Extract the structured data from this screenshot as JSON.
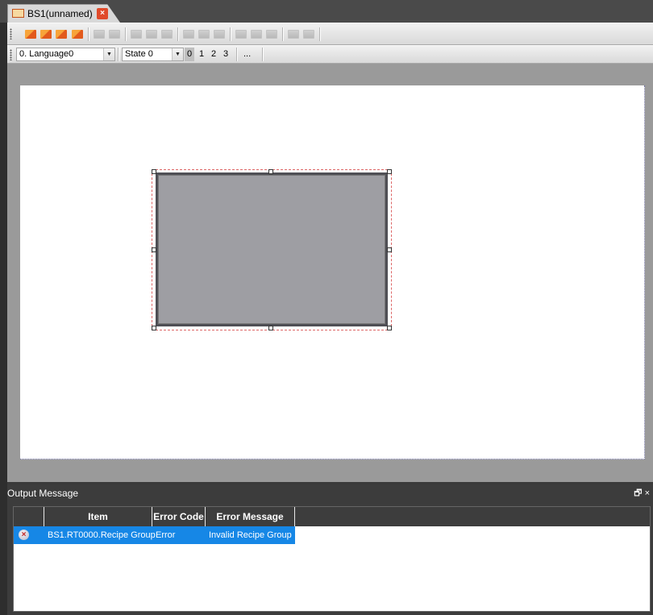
{
  "tab": {
    "title": "BS1(unnamed)",
    "close_glyph": "×"
  },
  "toolbar1": {
    "icons": [
      "bring-forward-icon",
      "bring-to-front-icon",
      "send-backward-icon",
      "send-to-back-icon",
      "group-icon",
      "ungroup-icon",
      "align-left-icon",
      "align-center-icon",
      "align-right-icon",
      "align-top-icon",
      "align-middle-icon",
      "align-bottom-icon",
      "distribute-horizontal-icon",
      "distribute-vertical-icon",
      "same-size-icon",
      "lock-icon",
      "unlock-icon"
    ]
  },
  "toolbar2": {
    "language_value": "0. Language0",
    "state_value": "State 0",
    "state_buttons": [
      "0",
      "1",
      "2",
      "3"
    ],
    "more_label": "..."
  },
  "output": {
    "title": "Output Message",
    "pin_glyph": "🗗 ×",
    "columns": [
      "Item",
      "Error Code",
      "Error Message"
    ],
    "rows": [
      {
        "item": "BS1.RT0000.Recipe Group",
        "error_code": "Error",
        "error_message": "Invalid Recipe Group"
      }
    ]
  },
  "colors": {
    "accent": "#1687e6",
    "selection_outline": "#dd6666",
    "tab_close": "#e04a2a"
  }
}
